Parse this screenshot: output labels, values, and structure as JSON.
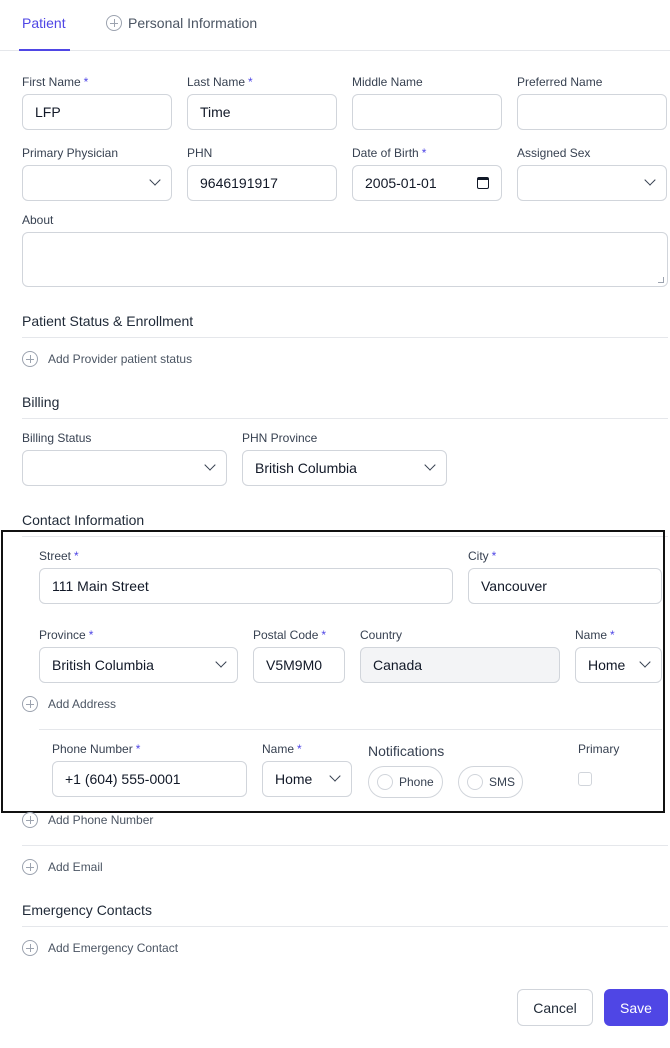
{
  "tabs": {
    "patient": "Patient",
    "personal_information": "Personal Information"
  },
  "patient": {
    "first_name": {
      "label": "First Name",
      "value": "LFP"
    },
    "last_name": {
      "label": "Last Name",
      "value": "Time"
    },
    "middle_name": {
      "label": "Middle Name",
      "value": ""
    },
    "preferred_name": {
      "label": "Preferred Name",
      "value": ""
    },
    "primary_physician": {
      "label": "Primary Physician",
      "value": ""
    },
    "phn": {
      "label": "PHN",
      "value": "9646191917"
    },
    "dob": {
      "label": "Date of Birth",
      "value": "2005-01-01"
    },
    "assigned_sex": {
      "label": "Assigned Sex",
      "value": ""
    },
    "about": {
      "label": "About",
      "value": ""
    }
  },
  "status_section": {
    "title": "Patient Status & Enrollment",
    "add_label": "Add Provider patient status"
  },
  "billing": {
    "title": "Billing",
    "status": {
      "label": "Billing Status",
      "value": ""
    },
    "phn_province": {
      "label": "PHN Province",
      "value": "British Columbia"
    }
  },
  "contact": {
    "title": "Contact Information",
    "street": {
      "label": "Street",
      "value": "111 Main Street"
    },
    "city": {
      "label": "City",
      "value": "Vancouver"
    },
    "province": {
      "label": "Province",
      "value": "British Columbia"
    },
    "postal_code": {
      "label": "Postal Code",
      "value": "V5M9M0"
    },
    "country": {
      "label": "Country",
      "value": "Canada"
    },
    "address_name": {
      "label": "Name",
      "value": "Home"
    },
    "add_address": "Add Address",
    "phone_number": {
      "label": "Phone Number",
      "value": "+1 (604) 555-0001"
    },
    "phone_name": {
      "label": "Name",
      "value": "Home"
    },
    "notifications": {
      "label": "Notifications",
      "phone": "Phone",
      "sms": "SMS"
    },
    "primary_label": "Primary",
    "add_phone": "Add Phone Number",
    "add_email": "Add Email"
  },
  "emergency": {
    "title": "Emergency Contacts",
    "add_label": "Add Emergency Contact"
  },
  "actions": {
    "cancel": "Cancel",
    "save": "Save"
  }
}
